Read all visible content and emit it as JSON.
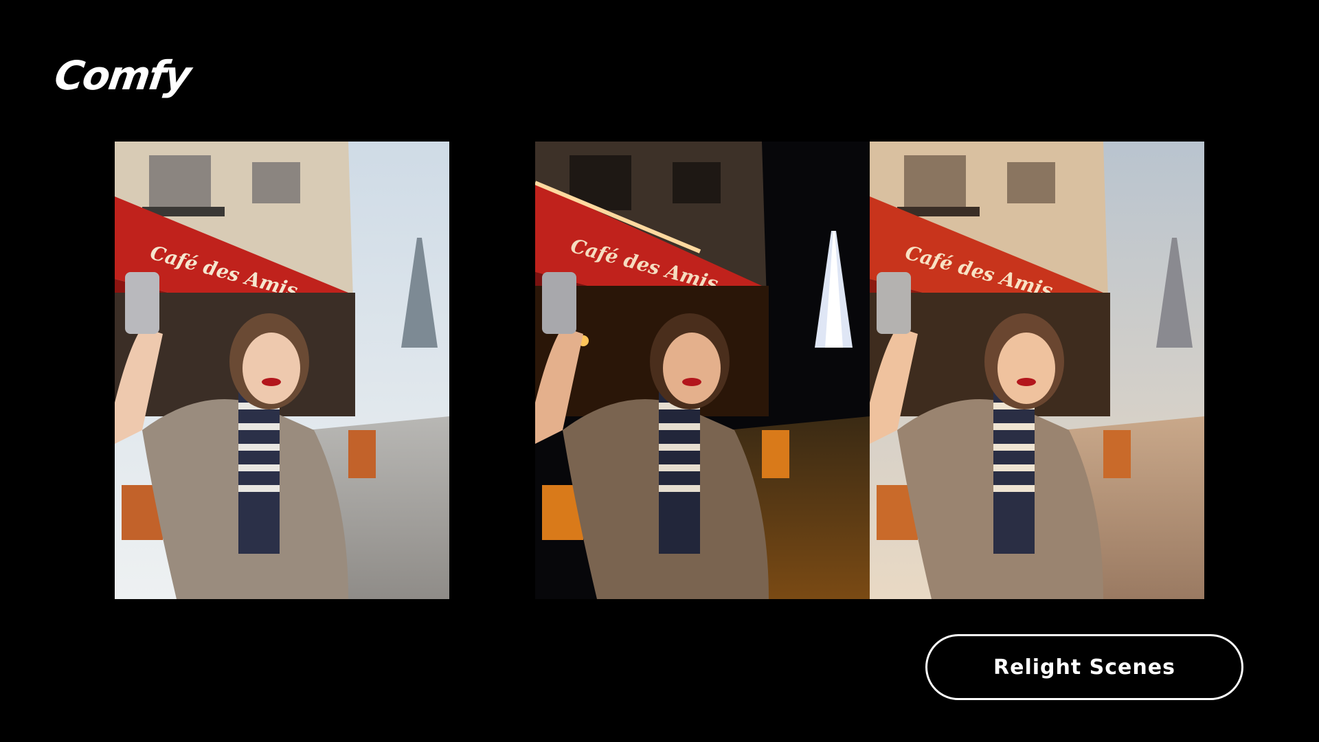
{
  "brand": {
    "logo_text": "Comfy"
  },
  "panels": [
    {
      "variant": "daylight",
      "sign_text": "Café des Amis"
    },
    {
      "variant": "night",
      "sign_text": "Café des Amis"
    },
    {
      "variant": "golden-hour",
      "sign_text": "Café des Amis"
    }
  ],
  "cta": {
    "label": "Relight Scenes"
  },
  "colors": {
    "background": "#000000",
    "text": "#ffffff",
    "awning": "#c0221c"
  }
}
